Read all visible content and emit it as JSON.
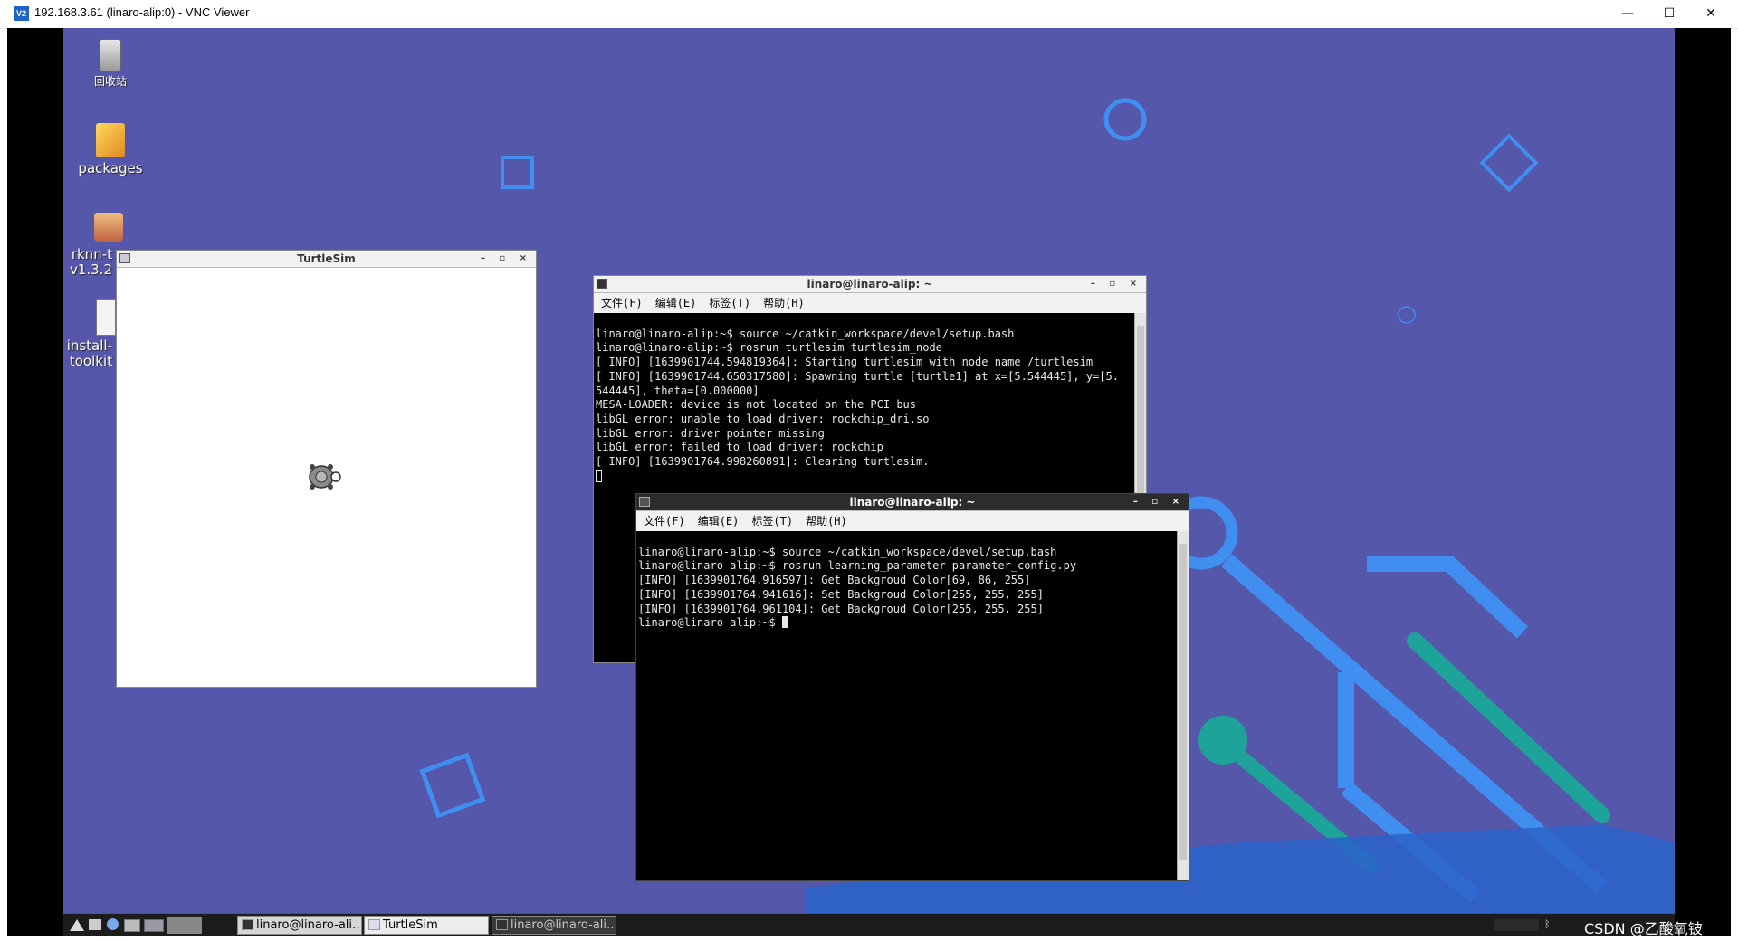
{
  "vnc": {
    "logo": "V2",
    "title": "192.168.3.61 (linaro-alip:0) - VNC Viewer",
    "minimize": "—",
    "maximize": "☐",
    "close": "✕"
  },
  "desktop_icons": [
    {
      "label": "回收站",
      "icon": "trash-icon"
    },
    {
      "label": "packages",
      "icon": "folder-icon"
    },
    {
      "label": "rknn-t\nv1.3.2",
      "icon": "package-icon"
    },
    {
      "label": "install-\ntoolkit",
      "icon": "script-icon"
    }
  ],
  "turtlesim": {
    "title": "TurtleSim",
    "controls": "– ▫ ×"
  },
  "terminal1": {
    "title": "linaro@linaro-alip: ~",
    "controls": "– ▫ ×",
    "menu": [
      "文件(F)",
      "编辑(E)",
      "标签(T)",
      "帮助(H)"
    ],
    "lines": [
      "linaro@linaro-alip:~$ source ~/catkin_workspace/devel/setup.bash",
      "linaro@linaro-alip:~$ rosrun turtlesim turtlesim_node",
      "[ INFO] [1639901744.594819364]: Starting turtlesim with node name /turtlesim",
      "[ INFO] [1639901744.650317580]: Spawning turtle [turtle1] at x=[5.544445], y=[5.",
      "544445], theta=[0.000000]",
      "MESA-LOADER: device is not located on the PCI bus",
      "libGL error: unable to load driver: rockchip_dri.so",
      "libGL error: driver pointer missing",
      "libGL error: failed to load driver: rockchip",
      "[ INFO] [1639901764.998260891]: Clearing turtlesim."
    ]
  },
  "terminal2": {
    "title": "linaro@linaro-alip: ~",
    "controls": "– ▫ ×",
    "menu": [
      "文件(F)",
      "编辑(E)",
      "标签(T)",
      "帮助(H)"
    ],
    "lines": [
      "linaro@linaro-alip:~$ source ~/catkin_workspace/devel/setup.bash",
      "linaro@linaro-alip:~$ rosrun learning_parameter parameter_config.py",
      "[INFO] [1639901764.916597]: Get Backgroud Color[69, 86, 255]",
      "[INFO] [1639901764.941616]: Set Backgroud Color[255, 255, 255]",
      "[INFO] [1639901764.961104]: Get Backgroud Color[255, 255, 255]"
    ],
    "prompt": "linaro@linaro-alip:~$ "
  },
  "taskbar": {
    "buttons": [
      {
        "label": "linaro@linaro-ali…",
        "active": true
      },
      {
        "label": "TurtleSim",
        "active": true
      },
      {
        "label": "linaro@linaro-ali…",
        "active": false
      }
    ],
    "watermark": "CSDN @乙酸氧铍"
  },
  "colors": {
    "desktop_bg": "#5557ab",
    "deco_blue": "#3f8ef0",
    "deco_teal": "#1ea39a",
    "terminal_bg": "#000000"
  }
}
